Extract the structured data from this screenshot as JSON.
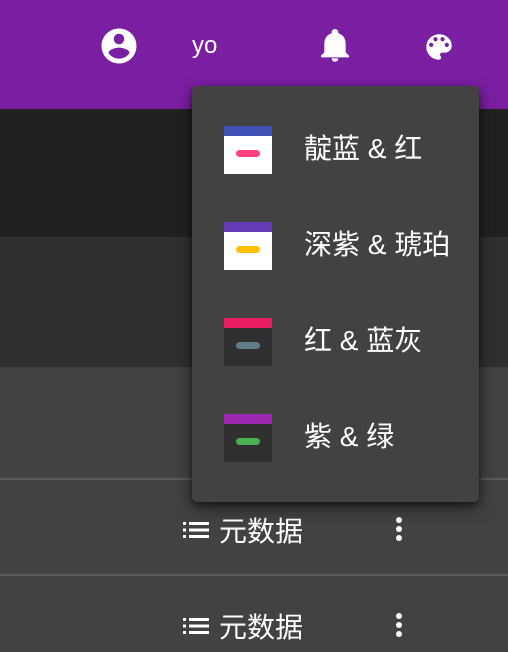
{
  "toolbar": {
    "username": "yo",
    "icons": [
      "account-circle-icon",
      "notifications-bell-icon",
      "palette-icon"
    ],
    "background_color": "#7b1fa2"
  },
  "theme_menu": {
    "items": [
      {
        "label": "靛蓝 & 红",
        "primary": "#3f51b5",
        "accent": "#ff4081",
        "surface": "#ffffff"
      },
      {
        "label": "深紫 & 琥珀",
        "primary": "#673ab7",
        "accent": "#ffc107",
        "surface": "#ffffff"
      },
      {
        "label": "红 & 蓝灰",
        "primary": "#e91e63",
        "accent": "#607d8b",
        "surface": "#303030"
      },
      {
        "label": "紫 & 绿",
        "primary": "#9c27b0",
        "accent": "#4caf50",
        "surface": "#303030"
      }
    ]
  },
  "table": {
    "rows": [
      {
        "label": "元数据",
        "icon": "list-icon",
        "action_icon": "more-vert-icon"
      },
      {
        "label": "元数据",
        "icon": "list-icon",
        "action_icon": "more-vert-icon"
      }
    ]
  }
}
